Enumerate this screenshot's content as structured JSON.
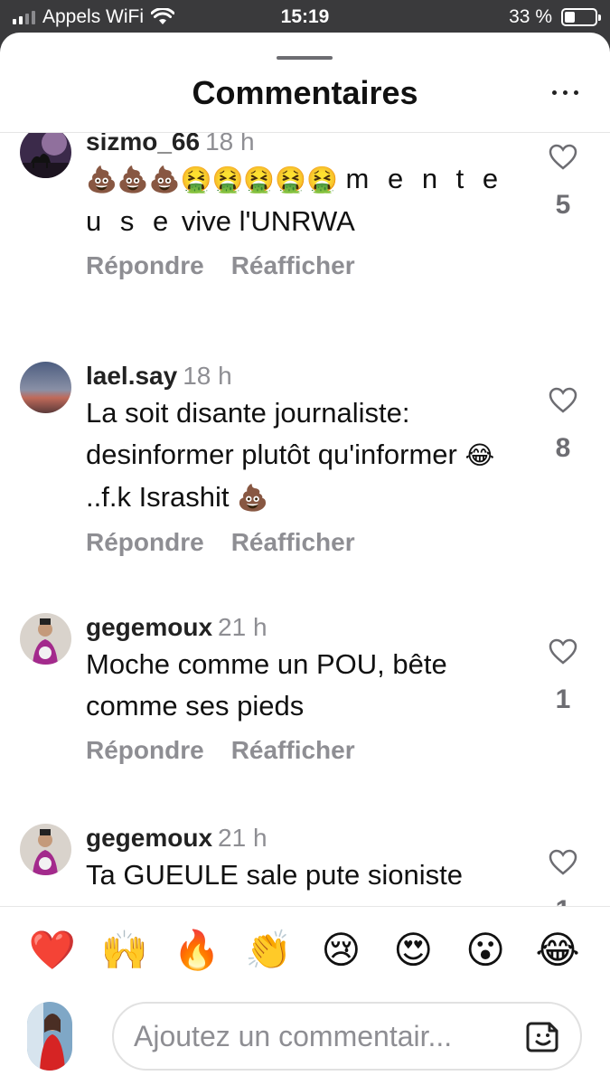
{
  "status_bar": {
    "carrier": "Appels WiFi",
    "time": "15:19",
    "battery_text": "33 %",
    "battery_level": 0.33
  },
  "header": {
    "title": "Commentaires"
  },
  "comments": [
    {
      "username": "sizmo_66",
      "time": "18 h",
      "emoji_prefix": "💩💩💩🤮🤮🤮🤮🤮",
      "text_spaced": "m e n t e u s e",
      "text": " vive l'UNRWA",
      "emoji_suffix": "",
      "likes": "5",
      "reply_label": "Répondre",
      "repost_label": "Réafficher"
    },
    {
      "username": "lael.say",
      "time": "18 h",
      "emoji_prefix": "",
      "text_spaced": "",
      "text": "La soit disante journaliste: desinformer plutôt qu'informer ",
      "emoji_mid": "😂",
      "text2": " ..f.k Israshit ",
      "emoji_suffix": "💩",
      "likes": "8",
      "reply_label": "Répondre",
      "repost_label": "Réafficher"
    },
    {
      "username": "gegemoux",
      "time": "21 h",
      "text": "Moche comme un POU, bête comme ses pieds",
      "likes": "1",
      "reply_label": "Répondre",
      "repost_label": "Réafficher"
    },
    {
      "username": "gegemoux",
      "time": "21 h",
      "text": "Ta GUEULE sale pute sioniste NAZI de merde",
      "likes": "1"
    }
  ],
  "reactions": [
    "❤️",
    "🙌",
    "🔥",
    "👏",
    "😢",
    "😍",
    "😮",
    "😂"
  ],
  "composer": {
    "placeholder": "Ajoutez un commentair..."
  },
  "colors": {
    "background": "#ffffff",
    "muted": "#8e8e93",
    "status_bar": "#3a3a3c"
  }
}
